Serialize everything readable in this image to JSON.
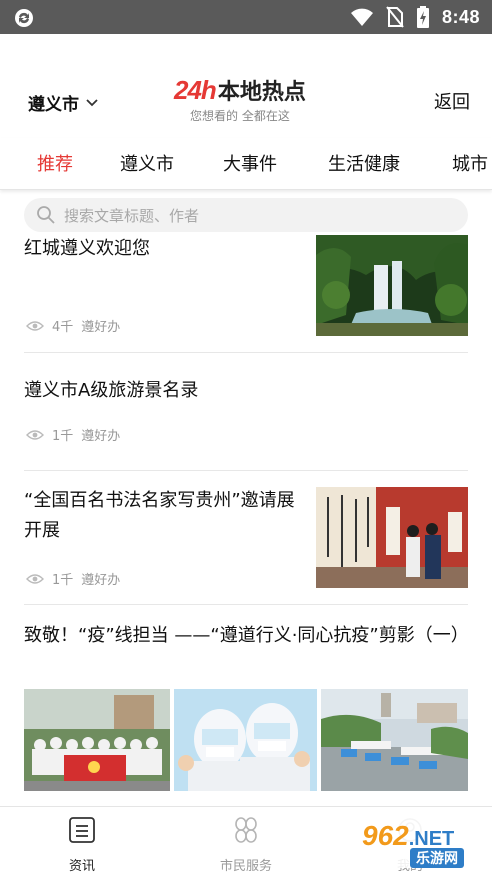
{
  "status_bar": {
    "time": "8:48",
    "icons": [
      "sync-icon",
      "wifi-icon",
      "no-sim-icon",
      "battery-charging-icon"
    ]
  },
  "header": {
    "city": "遵义市",
    "logo_brand": "24h",
    "logo_title": "本地热点",
    "logo_subtitle": "您想看的 全都在这",
    "back_label": "返回"
  },
  "tabs": [
    {
      "label": "推荐",
      "active": true
    },
    {
      "label": "遵义市",
      "active": false
    },
    {
      "label": "大事件",
      "active": false
    },
    {
      "label": "生活健康",
      "active": false
    },
    {
      "label": "城市",
      "active": false
    }
  ],
  "search": {
    "placeholder": "搜索文章标题、作者"
  },
  "articles": [
    {
      "title": "红城遵义欢迎您",
      "views": "4千",
      "source": "遵好办"
    },
    {
      "title": "遵义市A级旅游景名录",
      "views": "1千",
      "source": "遵好办"
    },
    {
      "title": "“全国百名书法名家写贵州”邀请展开展",
      "views": "1千",
      "source": "遵好办"
    },
    {
      "title": "致敬！“疫”线担当 ——“遵道行义·同心抗疫”剪影（一）"
    }
  ],
  "bottom_nav": [
    {
      "label": "资讯",
      "icon": "news-icon",
      "active": true
    },
    {
      "label": "市民服务",
      "icon": "services-icon",
      "active": false
    },
    {
      "label": "我的",
      "icon": "profile-icon",
      "active": false
    }
  ],
  "watermark": {
    "brand": "962",
    "suffix": ".NET",
    "text": "乐游网"
  },
  "colors": {
    "accent": "#e53935",
    "statusbar": "#5a5a5a",
    "muted": "#999999",
    "divider": "#e7e7e7"
  }
}
